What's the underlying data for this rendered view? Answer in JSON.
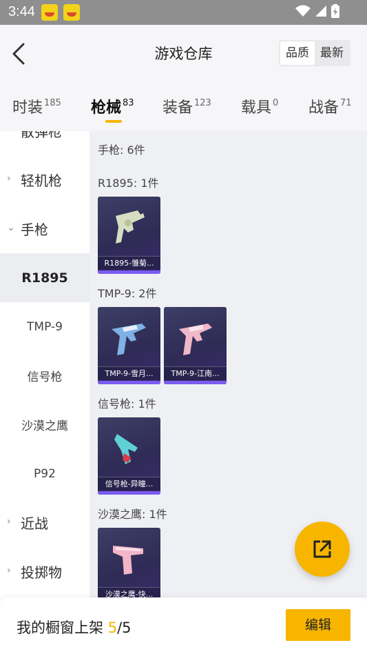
{
  "status": {
    "time": "3:44",
    "notifications": [
      "app-notification-icon",
      "app-notification-icon"
    ],
    "system_icons": [
      "wifi-icon",
      "signal-icon",
      "battery-icon"
    ]
  },
  "header": {
    "title": "游戏仓库",
    "sort_options": [
      "品质",
      "最新"
    ],
    "sort_active": "品质"
  },
  "tabs": [
    {
      "label": "时装",
      "count": "185"
    },
    {
      "label": "枪械",
      "count": "83",
      "active": true
    },
    {
      "label": "装备",
      "count": "123"
    },
    {
      "label": "载具",
      "count": "0"
    },
    {
      "label": "战备",
      "count": "71"
    }
  ],
  "sidebar": {
    "items": [
      {
        "label": "散弹枪",
        "type": "category"
      },
      {
        "label": "轻机枪",
        "type": "category"
      },
      {
        "label": "手枪",
        "type": "category",
        "expanded": true
      },
      {
        "label": "R1895",
        "type": "sub",
        "selected": true
      },
      {
        "label": "TMP-9",
        "type": "sub"
      },
      {
        "label": "信号枪",
        "type": "sub"
      },
      {
        "label": "沙漠之鹰",
        "type": "sub"
      },
      {
        "label": "P92",
        "type": "sub"
      },
      {
        "label": "近战",
        "type": "category"
      },
      {
        "label": "投掷物",
        "type": "category"
      }
    ]
  },
  "content": {
    "group_title": "手枪: 6件",
    "sections": [
      {
        "label": "R1895: 1件",
        "items": [
          "R1895-雏菊..."
        ]
      },
      {
        "label": "TMP-9: 2件",
        "items": [
          "TMP-9-雪月...",
          "TMP-9-江南..."
        ]
      },
      {
        "label": "信号枪: 1件",
        "items": [
          "信号枪-异瞳..."
        ]
      },
      {
        "label": "沙漠之鹰: 1件",
        "items": [
          "沙漠之鹰-快..."
        ]
      }
    ]
  },
  "bottom": {
    "showcase_label": "我的橱窗上架",
    "showcase_used": "5",
    "showcase_total": "/5",
    "edit_label": "编辑"
  },
  "colors": {
    "accent": "#f7b500",
    "card_bottom_bar": "#7a5cf0",
    "status_bar": "#8f8f8f"
  }
}
